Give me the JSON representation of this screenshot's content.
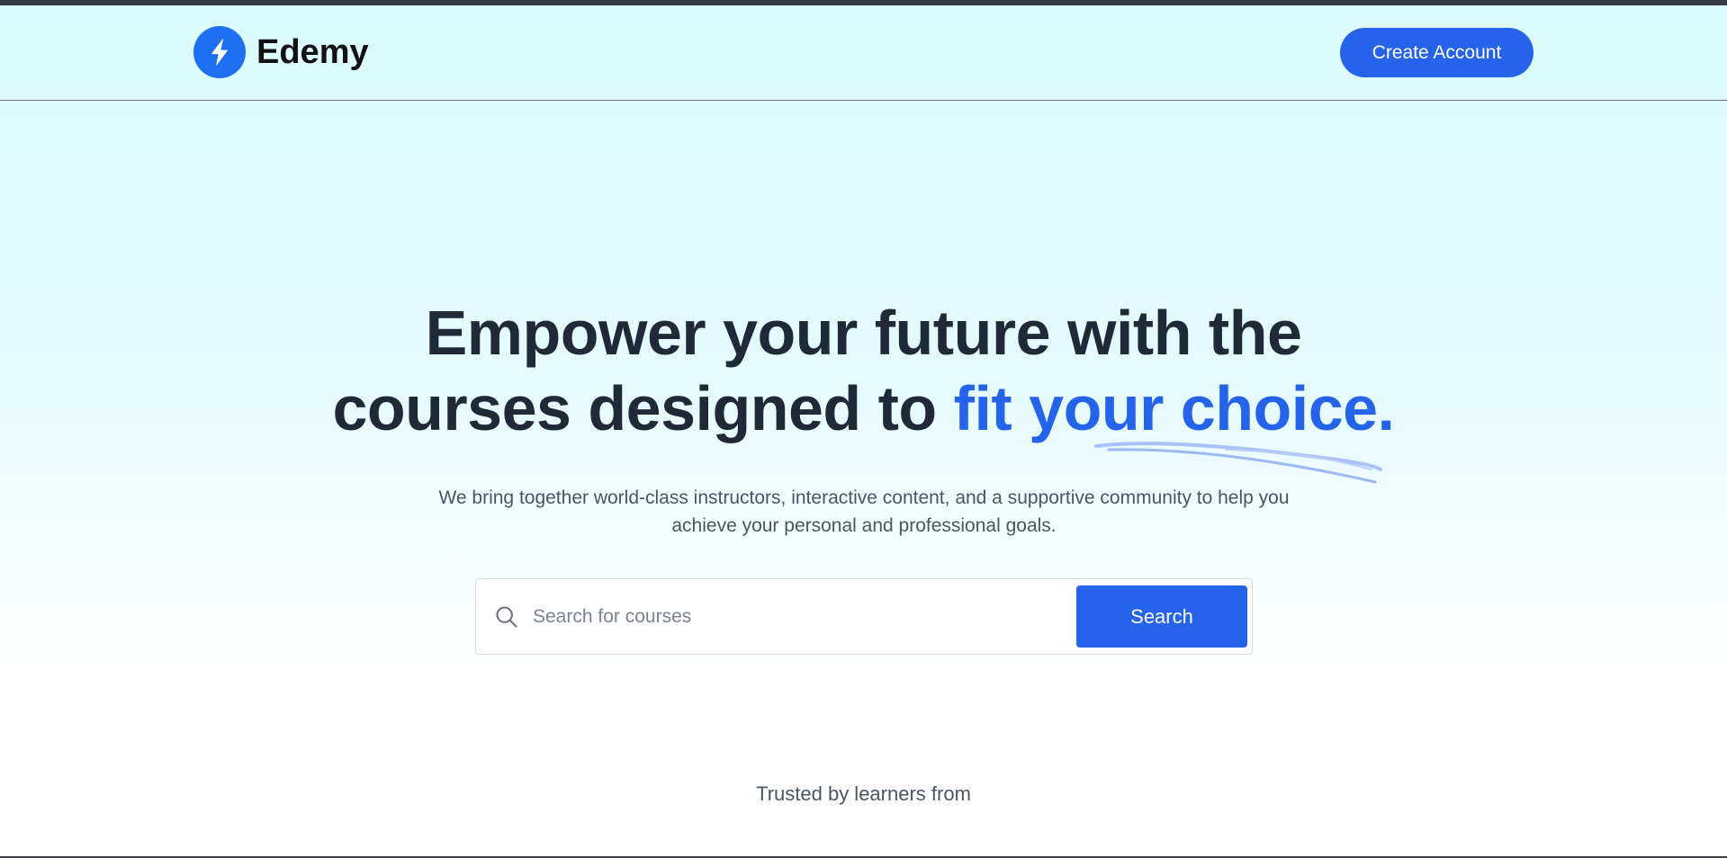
{
  "brand": {
    "name": "Edemy",
    "logo_icon": "lightning-bolt-icon",
    "logo_color": "#1f6ff2"
  },
  "header": {
    "cta_label": "Create Account"
  },
  "hero": {
    "title_part1": "Empower your future with the",
    "title_part2": "courses designed to ",
    "title_accent": "fit your choice.",
    "subtitle": "We bring together world-class instructors, interactive content, and a supportive community to help you achieve your personal and professional goals."
  },
  "search": {
    "placeholder": "Search for courses",
    "value": "",
    "button_label": "Search",
    "icon": "search-icon"
  },
  "trusted": {
    "label": "Trusted by learners from"
  },
  "colors": {
    "accent": "#2563eb",
    "heading": "#1f2937",
    "body_text": "#4b5563",
    "hero_background": "#dafbfd"
  }
}
